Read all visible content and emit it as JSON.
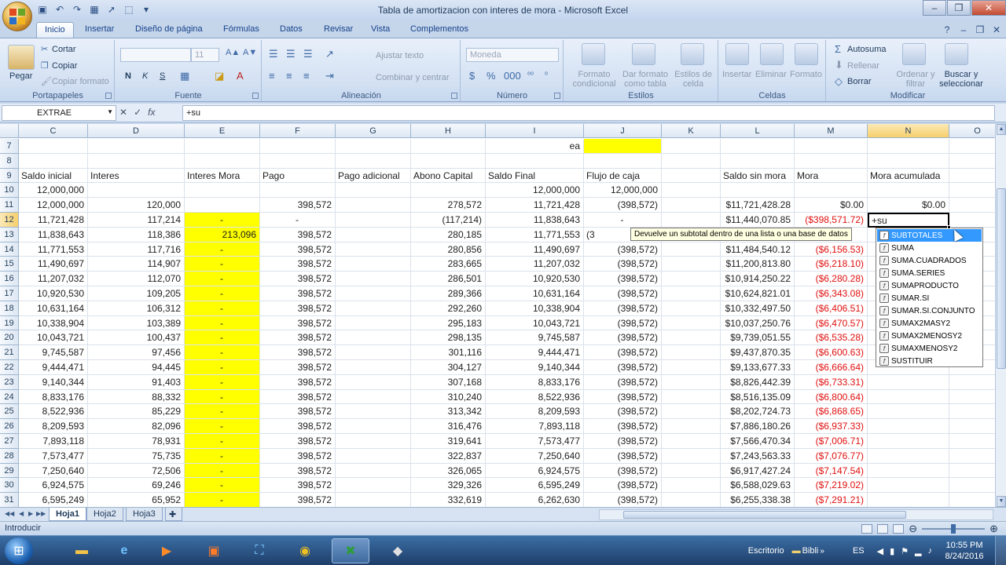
{
  "window": {
    "title": "Tabla de amortizacion con interes de mora - Microsoft Excel",
    "minimize": "–",
    "restore": "❐",
    "close": "✕"
  },
  "ribbon_tabs": [
    "Inicio",
    "Insertar",
    "Diseño de página",
    "Fórmulas",
    "Datos",
    "Revisar",
    "Vista",
    "Complementos"
  ],
  "ribbon": {
    "clipboard": {
      "paste": "Pegar",
      "cut": "Cortar",
      "copy": "Copiar",
      "format_painter": "Copiar formato",
      "label": "Portapapeles"
    },
    "font": {
      "font_name": "",
      "font_size": "11",
      "label": "Fuente",
      "bold": "N",
      "italic": "K",
      "underline": "S"
    },
    "alignment": {
      "wrap": "Ajustar texto",
      "merge": "Combinar y centrar",
      "label": "Alineación"
    },
    "number": {
      "format": "Moneda",
      "label": "Número"
    },
    "styles": {
      "conditional": "Formato condicional",
      "table": "Dar formato como tabla",
      "cell_styles": "Estilos de celda",
      "label": "Estilos"
    },
    "cells": {
      "insert": "Insertar",
      "delete": "Eliminar",
      "format": "Formato",
      "label": "Celdas"
    },
    "editing": {
      "autosum": "Autosuma",
      "fill": "Rellenar",
      "clear": "Borrar",
      "sort": "Ordenar y filtrar",
      "find": "Buscar y seleccionar",
      "label": "Modificar"
    }
  },
  "formula_bar": {
    "name_box": "EXTRAE",
    "formula": "+su",
    "fx": "fx"
  },
  "columns": [
    "C",
    "D",
    "E",
    "F",
    "G",
    "H",
    "I",
    "J",
    "K",
    "L",
    "M",
    "N",
    "O"
  ],
  "rows": [
    {
      "num": "7",
      "cells": [
        "",
        "",
        "",
        "",
        "",
        "",
        "ea",
        "",
        "",
        "",
        "",
        "",
        ""
      ]
    },
    {
      "num": "8",
      "cells": [
        "",
        "",
        "",
        "",
        "",
        "",
        "",
        "",
        "",
        "",
        "",
        "",
        ""
      ]
    },
    {
      "num": "9",
      "cells": [
        "Saldo inicial",
        "Interes",
        "Interes Mora",
        "Pago",
        "Pago adicional",
        "Abono Capital",
        "Saldo Final",
        "Flujo de caja",
        "",
        "Saldo sin mora",
        "Mora",
        "Mora acumulada",
        ""
      ]
    },
    {
      "num": "10",
      "cells": [
        "12,000,000",
        "",
        "",
        "",
        "",
        "",
        "12,000,000",
        "12,000,000",
        "",
        "",
        "",
        "",
        ""
      ]
    },
    {
      "num": "11",
      "cells": [
        "12,000,000",
        "120,000",
        "",
        "398,572",
        "",
        "278,572",
        "11,721,428",
        "(398,572)",
        "",
        "$11,721,428.28",
        "$0.00",
        "$0.00",
        ""
      ]
    },
    {
      "num": "12",
      "cells": [
        "11,721,428",
        "117,214",
        "-",
        "-",
        "",
        "(117,214)",
        "11,838,643",
        "-",
        "",
        "$11,440,070.85",
        "($398,571.72)",
        "+su",
        ""
      ]
    },
    {
      "num": "13",
      "cells": [
        "11,838,643",
        "118,386",
        "213,096",
        "398,572",
        "",
        "280,185",
        "11,771,553",
        "(3",
        "",
        "",
        "",
        "",
        ""
      ]
    },
    {
      "num": "14",
      "cells": [
        "11,771,553",
        "117,716",
        "-",
        "398,572",
        "",
        "280,856",
        "11,490,697",
        "(398,572)",
        "",
        "$11,484,540.12",
        "($6,156.53)",
        "",
        ""
      ]
    },
    {
      "num": "15",
      "cells": [
        "11,490,697",
        "114,907",
        "-",
        "398,572",
        "",
        "283,665",
        "11,207,032",
        "(398,572)",
        "",
        "$11,200,813.80",
        "($6,218.10)",
        "",
        ""
      ]
    },
    {
      "num": "16",
      "cells": [
        "11,207,032",
        "112,070",
        "-",
        "398,572",
        "",
        "286,501",
        "10,920,530",
        "(398,572)",
        "",
        "$10,914,250.22",
        "($6,280.28)",
        "",
        ""
      ]
    },
    {
      "num": "17",
      "cells": [
        "10,920,530",
        "109,205",
        "-",
        "398,572",
        "",
        "289,366",
        "10,631,164",
        "(398,572)",
        "",
        "$10,624,821.01",
        "($6,343.08)",
        "",
        ""
      ]
    },
    {
      "num": "18",
      "cells": [
        "10,631,164",
        "106,312",
        "-",
        "398,572",
        "",
        "292,260",
        "10,338,904",
        "(398,572)",
        "",
        "$10,332,497.50",
        "($6,406.51)",
        "",
        ""
      ]
    },
    {
      "num": "19",
      "cells": [
        "10,338,904",
        "103,389",
        "-",
        "398,572",
        "",
        "295,183",
        "10,043,721",
        "(398,572)",
        "",
        "$10,037,250.76",
        "($6,470.57)",
        "",
        ""
      ]
    },
    {
      "num": "20",
      "cells": [
        "10,043,721",
        "100,437",
        "-",
        "398,572",
        "",
        "298,135",
        "9,745,587",
        "(398,572)",
        "",
        "$9,739,051.55",
        "($6,535.28)",
        "",
        ""
      ]
    },
    {
      "num": "21",
      "cells": [
        "9,745,587",
        "97,456",
        "-",
        "398,572",
        "",
        "301,116",
        "9,444,471",
        "(398,572)",
        "",
        "$9,437,870.35",
        "($6,600.63)",
        "",
        ""
      ]
    },
    {
      "num": "22",
      "cells": [
        "9,444,471",
        "94,445",
        "-",
        "398,572",
        "",
        "304,127",
        "9,140,344",
        "(398,572)",
        "",
        "$9,133,677.33",
        "($6,666.64)",
        "",
        ""
      ]
    },
    {
      "num": "23",
      "cells": [
        "9,140,344",
        "91,403",
        "-",
        "398,572",
        "",
        "307,168",
        "8,833,176",
        "(398,572)",
        "",
        "$8,826,442.39",
        "($6,733.31)",
        "",
        ""
      ]
    },
    {
      "num": "24",
      "cells": [
        "8,833,176",
        "88,332",
        "-",
        "398,572",
        "",
        "310,240",
        "8,522,936",
        "(398,572)",
        "",
        "$8,516,135.09",
        "($6,800.64)",
        "",
        ""
      ]
    },
    {
      "num": "25",
      "cells": [
        "8,522,936",
        "85,229",
        "-",
        "398,572",
        "",
        "313,342",
        "8,209,593",
        "(398,572)",
        "",
        "$8,202,724.73",
        "($6,868.65)",
        "",
        ""
      ]
    },
    {
      "num": "26",
      "cells": [
        "8,209,593",
        "82,096",
        "-",
        "398,572",
        "",
        "316,476",
        "7,893,118",
        "(398,572)",
        "",
        "$7,886,180.26",
        "($6,937.33)",
        "",
        ""
      ]
    },
    {
      "num": "27",
      "cells": [
        "7,893,118",
        "78,931",
        "-",
        "398,572",
        "",
        "319,641",
        "7,573,477",
        "(398,572)",
        "",
        "$7,566,470.34",
        "($7,006.71)",
        "",
        ""
      ]
    },
    {
      "num": "28",
      "cells": [
        "7,573,477",
        "75,735",
        "-",
        "398,572",
        "",
        "322,837",
        "7,250,640",
        "(398,572)",
        "",
        "$7,243,563.33",
        "($7,076.77)",
        "",
        ""
      ]
    },
    {
      "num": "29",
      "cells": [
        "7,250,640",
        "72,506",
        "-",
        "398,572",
        "",
        "326,065",
        "6,924,575",
        "(398,572)",
        "",
        "$6,917,427.24",
        "($7,147.54)",
        "",
        ""
      ]
    },
    {
      "num": "30",
      "cells": [
        "6,924,575",
        "69,246",
        "-",
        "398,572",
        "",
        "329,326",
        "6,595,249",
        "(398,572)",
        "",
        "$6,588,029.63",
        "($7,219.02)",
        "",
        ""
      ]
    },
    {
      "num": "31",
      "cells": [
        "6,595,249",
        "65,952",
        "-",
        "398,572",
        "",
        "332,619",
        "6,262,630",
        "(398,572)",
        "",
        "$6,255,338.38",
        "($7,291.21)",
        "",
        ""
      ]
    }
  ],
  "tooltip": "Devuelve un subtotal dentro de una lista o una base de datos",
  "autocomplete": [
    "SUBTOTALES",
    "SUMA",
    "SUMA.CUADRADOS",
    "SUMA.SERIES",
    "SUMAPRODUCTO",
    "SUMAR.SI",
    "SUMAR.SI.CONJUNTO",
    "SUMAX2MASY2",
    "SUMAX2MENOSY2",
    "SUMAXMENOSY2",
    "SUSTITUIR"
  ],
  "sheets": [
    "Hoja1",
    "Hoja2",
    "Hoja3"
  ],
  "status": {
    "mode": "Introducir"
  },
  "taskbar": {
    "desktop": "Escritorio",
    "library": "Bibli",
    "lang": "ES",
    "time": "10:55 PM",
    "date": "8/24/2016"
  },
  "colors": {
    "yellow": "#ffff00",
    "negative": "#e01010",
    "selection": "#3399ff"
  }
}
